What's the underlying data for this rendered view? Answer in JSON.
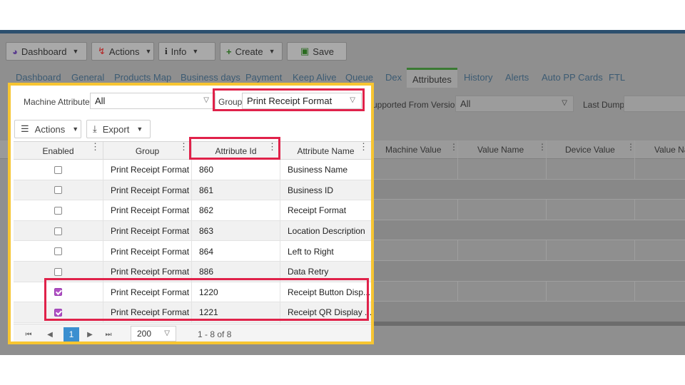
{
  "toolbar": {
    "dashboard": "Dashboard",
    "actions": "Actions",
    "info": "Info",
    "create": "Create",
    "save": "Save"
  },
  "tabs": [
    "Dashboard",
    "General",
    "Products Map",
    "Business days",
    "Payment",
    "Keep Alive",
    "Queue",
    "Dex",
    "Attributes",
    "History",
    "Alerts",
    "Auto PP Cards",
    "FTL"
  ],
  "active_tab": "Attributes",
  "filters": {
    "machine_attributes_label": "Machine Attributes",
    "machine_attributes_value": "All",
    "group_label": "Group",
    "group_value": "Print Receipt Format",
    "supported_from_label": "upported From Version",
    "supported_from_value": "All",
    "last_dump_label": "Last Dump:"
  },
  "grid_toolbar": {
    "actions": "Actions",
    "export": "Export"
  },
  "columns": {
    "enabled": "Enabled",
    "group": "Group",
    "attribute_id": "Attribute Id",
    "attribute_name": "Attribute Name",
    "machine_value": "Machine Value",
    "value_name": "Value Name",
    "device_value": "Device Value",
    "value_name_2": "Value Na"
  },
  "rows": [
    {
      "enabled": false,
      "group": "Print Receipt Format",
      "id": "860",
      "name": "Business Name"
    },
    {
      "enabled": false,
      "group": "Print Receipt Format",
      "id": "861",
      "name": "Business ID"
    },
    {
      "enabled": false,
      "group": "Print Receipt Format",
      "id": "862",
      "name": "Receipt Format"
    },
    {
      "enabled": false,
      "group": "Print Receipt Format",
      "id": "863",
      "name": "Location Description"
    },
    {
      "enabled": false,
      "group": "Print Receipt Format",
      "id": "864",
      "name": "Left to Right"
    },
    {
      "enabled": false,
      "group": "Print Receipt Format",
      "id": "886",
      "name": "Data Retry"
    },
    {
      "enabled": true,
      "group": "Print Receipt Format",
      "id": "1220",
      "name": "Receipt Button Disp..."
    },
    {
      "enabled": true,
      "group": "Print Receipt Format",
      "id": "1221",
      "name": "Receipt QR Display ..."
    }
  ],
  "pager": {
    "current_page": "1",
    "page_size": "200",
    "range": "1 - 8 of 8"
  },
  "colors": {
    "highlight_panel": "#f7c531",
    "highlight_box": "#e0224a",
    "checkbox_on": "#b04fc4",
    "pager_active": "#3b8fd0"
  }
}
